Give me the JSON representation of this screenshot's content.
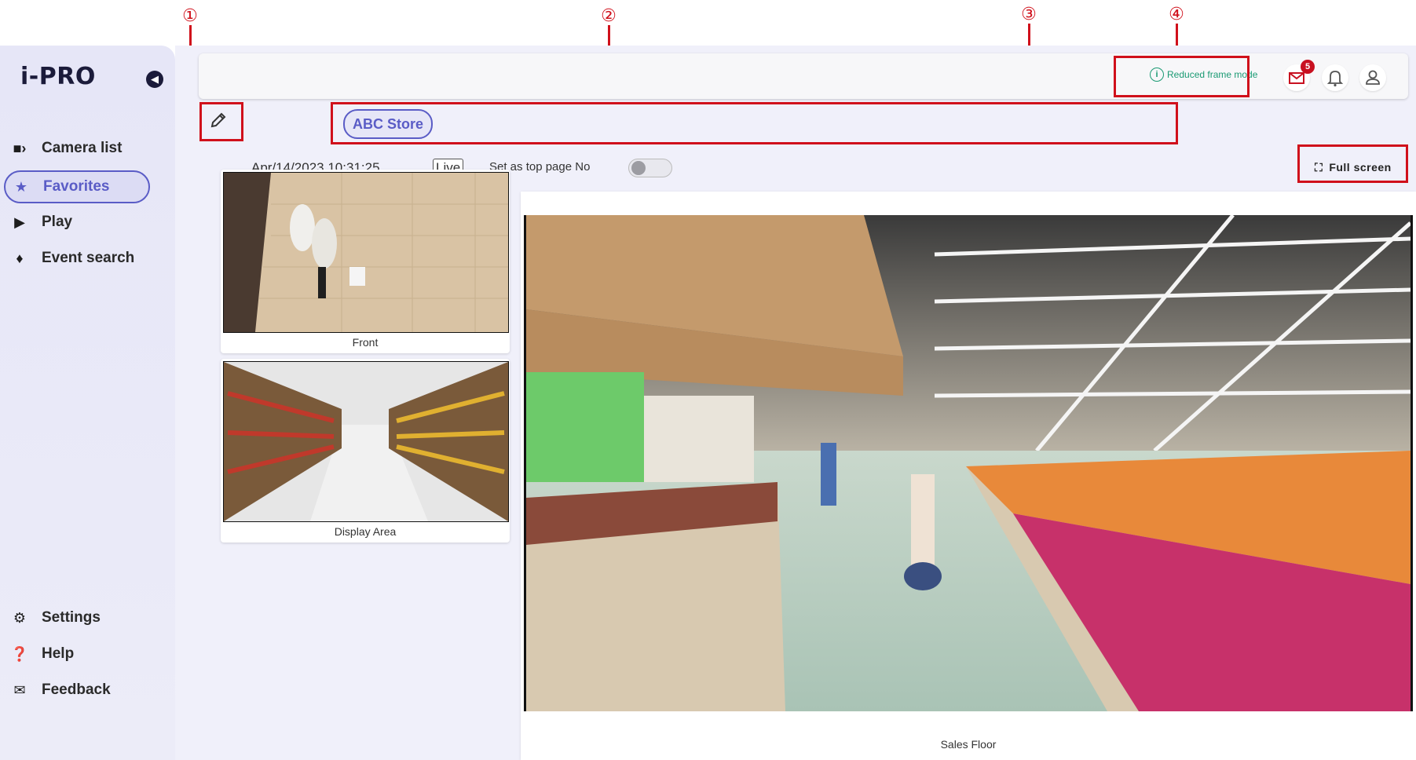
{
  "annotations": [
    "①",
    "②",
    "③",
    "④"
  ],
  "sidebar": {
    "logo": "i-PRO",
    "items": [
      {
        "label": "Camera list",
        "icon": "video-camera-icon"
      },
      {
        "label": "Favorites",
        "icon": "star-icon",
        "active": true
      },
      {
        "label": "Play",
        "icon": "play-icon"
      },
      {
        "label": "Event search",
        "icon": "bell-icon"
      },
      {
        "label": "Settings",
        "icon": "gear-icon"
      },
      {
        "label": "Help",
        "icon": "help-icon"
      },
      {
        "label": "Feedback",
        "icon": "envelope-icon"
      }
    ]
  },
  "header": {
    "reduced_frame_label": "Reduced frame mode",
    "mail_badge": "5"
  },
  "toolbar": {
    "store_tag": "ABC Store",
    "datetime": "Apr/14/2023 10:31:25",
    "live_label": "Live",
    "set_top_page_label": "Set as top page No",
    "fullscreen_label": "Full screen"
  },
  "cameras": {
    "thumb1_caption": "Front",
    "thumb2_caption": "Display Area",
    "main_caption": "Sales Floor"
  },
  "colors": {
    "accent": "#5a5cc6",
    "annotation_red": "#d0101b",
    "status_green": "#1a9a73",
    "sidebar_bg": "#e6e6f7"
  }
}
